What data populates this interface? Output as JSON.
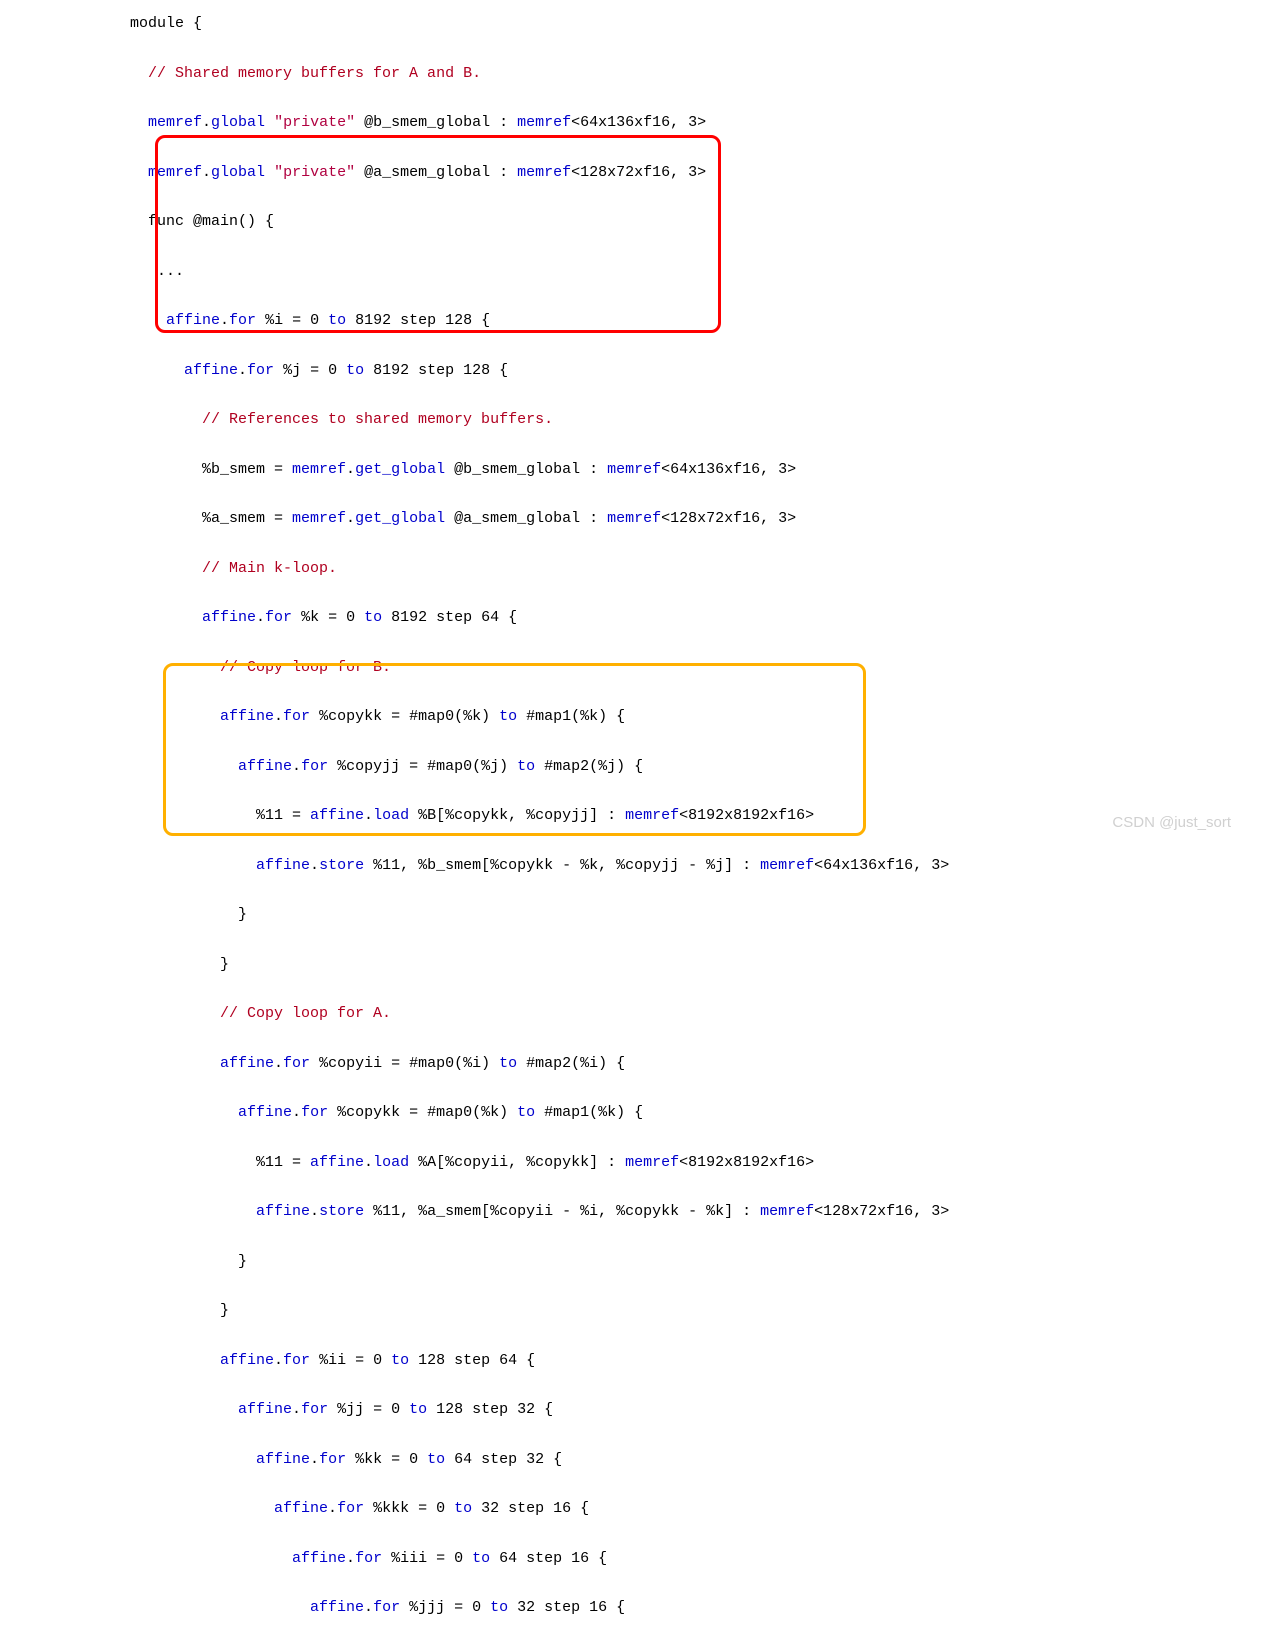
{
  "watermark": "CSDN @just_sort",
  "code": {
    "l01": "module {",
    "l02_a": "  ",
    "l02_cm": "// Shared memory buffers for A and B.",
    "l03_a": "  ",
    "l03_k1": "memref",
    "l03_b": ".",
    "l03_k2": "global",
    "l03_c": " ",
    "l03_str": "\"private\"",
    "l03_d": " @b_smem_global : ",
    "l03_k3": "memref",
    "l03_e": "<64x136xf16, 3>",
    "l04_a": "  ",
    "l04_k1": "memref",
    "l04_b": ".",
    "l04_k2": "global",
    "l04_c": " ",
    "l04_str": "\"private\"",
    "l04_d": " @a_smem_global : ",
    "l04_k3": "memref",
    "l04_e": "<128x72xf16, 3>",
    "l05": "  func @main() {",
    "l06": "   ...",
    "l07_a": "    ",
    "l07_k1": "affine",
    "l07_b": ".",
    "l07_k2": "for",
    "l07_c": " %i = 0 ",
    "l07_k3": "to",
    "l07_d": " 8192 step 128 {",
    "l08_a": "      ",
    "l08_k1": "affine",
    "l08_b": ".",
    "l08_k2": "for",
    "l08_c": " %j = 0 ",
    "l08_k3": "to",
    "l08_d": " 8192 step 128 {",
    "l09_a": "        ",
    "l09_cm": "// References to shared memory buffers.",
    "l10_a": "        %b_smem = ",
    "l10_k1": "memref",
    "l10_b": ".",
    "l10_k2": "get_global",
    "l10_c": " @b_smem_global : ",
    "l10_k3": "memref",
    "l10_d": "<64x136xf16, 3>",
    "l11_a": "        %a_smem = ",
    "l11_k1": "memref",
    "l11_b": ".",
    "l11_k2": "get_global",
    "l11_c": " @a_smem_global : ",
    "l11_k3": "memref",
    "l11_d": "<128x72xf16, 3>",
    "l12_a": "        ",
    "l12_cm": "// Main k-loop.",
    "l13_a": "        ",
    "l13_k1": "affine",
    "l13_b": ".",
    "l13_k2": "for",
    "l13_c": " %k = 0 ",
    "l13_k3": "to",
    "l13_d": " 8192 step 64 {",
    "l14_a": "          ",
    "l14_cm": "// Copy loop for B.",
    "l15_a": "          ",
    "l15_k1": "affine",
    "l15_b": ".",
    "l15_k2": "for",
    "l15_c": " %copykk = #map0(%k) ",
    "l15_k3": "to",
    "l15_d": " #map1(%k) {",
    "l16_a": "            ",
    "l16_k1": "affine",
    "l16_b": ".",
    "l16_k2": "for",
    "l16_c": " %copyjj = #map0(%j) ",
    "l16_k3": "to",
    "l16_d": " #map2(%j) {",
    "l17_a": "              %11 = ",
    "l17_k1": "affine",
    "l17_b": ".",
    "l17_k2": "load",
    "l17_c": " %B[%copykk, %copyjj] : ",
    "l17_k3": "memref",
    "l17_d": "<8192x8192xf16>",
    "l18_a": "              ",
    "l18_k1": "affine",
    "l18_b": ".",
    "l18_k2": "store",
    "l18_c": " %11, %b_smem[%copykk - %k, %copyjj - %j] : ",
    "l18_k3": "memref",
    "l18_d": "<64x136xf16, 3>",
    "l19": "            }",
    "l20": "          }",
    "l21_a": "          ",
    "l21_cm": "// Copy loop for A.",
    "l22_a": "          ",
    "l22_k1": "affine",
    "l22_b": ".",
    "l22_k2": "for",
    "l22_c": " %copyii = #map0(%i) ",
    "l22_k3": "to",
    "l22_d": " #map2(%i) {",
    "l23_a": "            ",
    "l23_k1": "affine",
    "l23_b": ".",
    "l23_k2": "for",
    "l23_c": " %copykk = #map0(%k) ",
    "l23_k3": "to",
    "l23_d": " #map1(%k) {",
    "l24_a": "              %11 = ",
    "l24_k1": "affine",
    "l24_b": ".",
    "l24_k2": "load",
    "l24_c": " %A[%copyii, %copykk] : ",
    "l24_k3": "memref",
    "l24_d": "<8192x8192xf16>",
    "l25_a": "              ",
    "l25_k1": "affine",
    "l25_b": ".",
    "l25_k2": "store",
    "l25_c": " %11, %a_smem[%copyii - %i, %copykk - %k] : ",
    "l25_k3": "memref",
    "l25_d": "<128x72xf16, 3>",
    "l26": "            }",
    "l27": "          }",
    "l28_a": "          ",
    "l28_k1": "affine",
    "l28_b": ".",
    "l28_k2": "for",
    "l28_c": " %ii = 0 ",
    "l28_k3": "to",
    "l28_d": " 128 step 64 {",
    "l29_a": "            ",
    "l29_k1": "affine",
    "l29_b": ".",
    "l29_k2": "for",
    "l29_c": " %jj = 0 ",
    "l29_k3": "to",
    "l29_d": " 128 step 32 {",
    "l30_a": "              ",
    "l30_k1": "affine",
    "l30_b": ".",
    "l30_k2": "for",
    "l30_c": " %kk = 0 ",
    "l30_k3": "to",
    "l30_d": " 64 step 32 {",
    "l31_a": "                ",
    "l31_k1": "affine",
    "l31_b": ".",
    "l31_k2": "for",
    "l31_c": " %kkk = 0 ",
    "l31_k3": "to",
    "l31_d": " 32 step 16 {",
    "l32_a": "                  ",
    "l32_k1": "affine",
    "l32_b": ".",
    "l32_k2": "for",
    "l32_c": " %iii = 0 ",
    "l32_k3": "to",
    "l32_d": " 64 step 16 {",
    "l33_a": "                    ",
    "l33_k1": "affine",
    "l33_b": ".",
    "l33_k2": "for",
    "l33_c": " %jjj = 0 ",
    "l33_k3": "to",
    "l33_d": " 32 step 16 {"
  }
}
